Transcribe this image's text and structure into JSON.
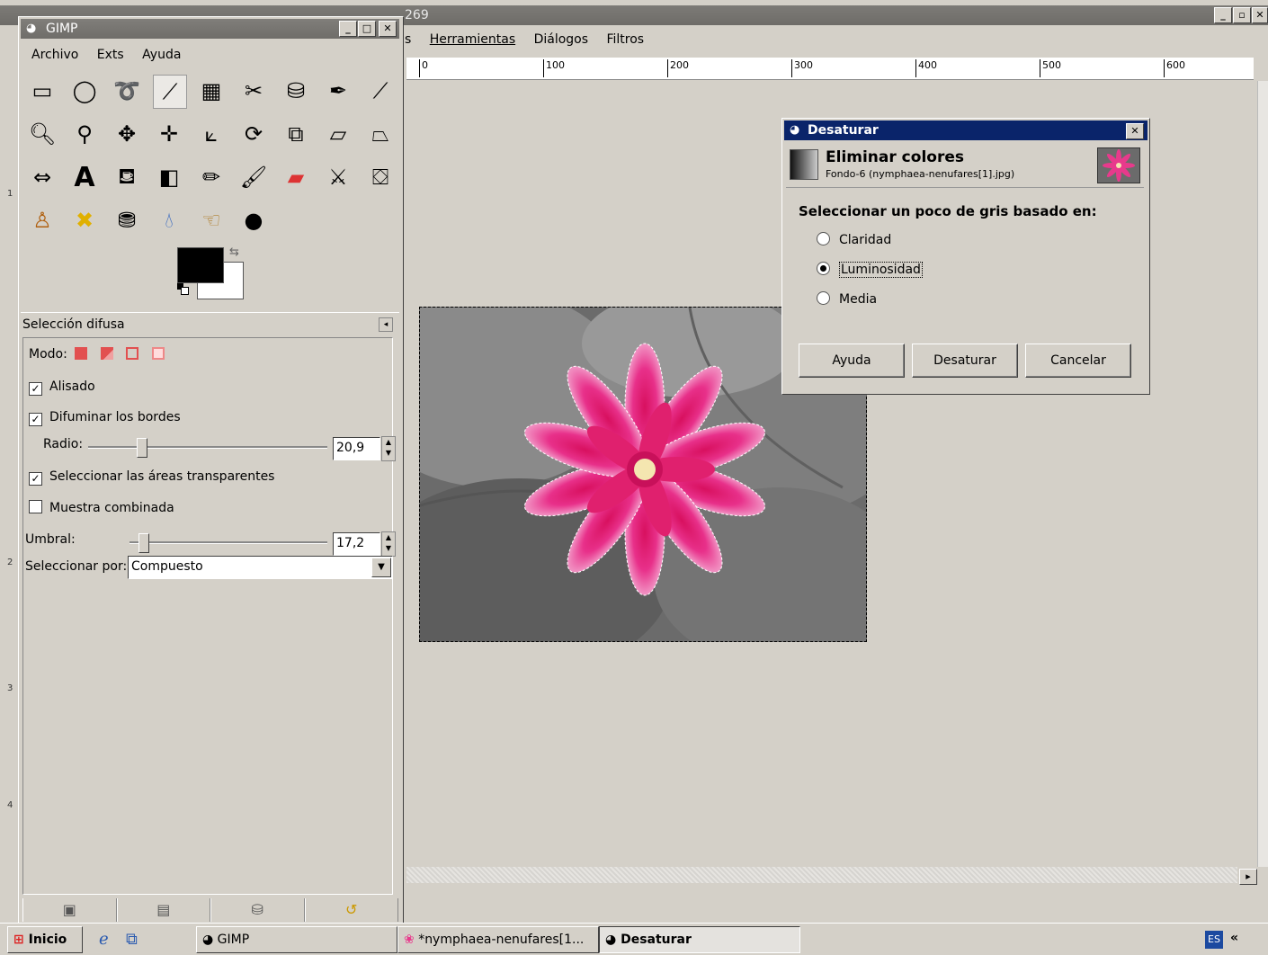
{
  "image_window": {
    "title": "269",
    "menu": [
      "s",
      "Herramientas",
      "Diálogos",
      "Filtros"
    ],
    "ruler_labels": [
      "0",
      "100",
      "200",
      "300",
      "400",
      "500",
      "600"
    ],
    "left_ruler_labels": [
      "1",
      "2",
      "3",
      "4"
    ]
  },
  "toolbox": {
    "title": "GIMP",
    "menu": [
      "Archivo",
      "Exts",
      "Ayuda"
    ],
    "tool_options": {
      "title": "Selección difusa",
      "mode_label": "Modo:",
      "antialias_label": "Alisado",
      "antialias_checked": true,
      "feather_label": "Difuminar los bordes",
      "feather_checked": true,
      "radius_label": "Radio:",
      "radius_value": "20,9",
      "radius_fraction": 0.22,
      "select_transparent_label": "Seleccionar las áreas transparentes",
      "select_transparent_checked": true,
      "sample_merged_label": "Muestra combinada",
      "sample_merged_checked": false,
      "threshold_label": "Umbral:",
      "threshold_value": "17,2",
      "threshold_fraction": 0.07,
      "select_by_label": "Seleccionar por:",
      "select_by_value": "Compuesto"
    }
  },
  "dialog": {
    "title": "Desaturar",
    "header_title": "Eliminar colores",
    "header_subtitle": "Fondo-6 (nymphaea-nenufares[1].jpg)",
    "prompt": "Seleccionar un poco de gris basado en:",
    "options": [
      "Claridad",
      "Luminosidad",
      "Media"
    ],
    "selected_option": "Luminosidad",
    "buttons": {
      "help": "Ayuda",
      "desaturate": "Desaturar",
      "cancel": "Cancelar"
    }
  },
  "taskbar": {
    "start_label": "Inicio",
    "tasks": [
      "GIMP",
      "*nymphaea-nenufares[1...",
      "Desaturar"
    ],
    "active_task": "Desaturar",
    "language": "ES",
    "tray_arrows": "«"
  },
  "colors": {
    "dialog_titlebar": "#0a246a",
    "flower_pink": "#e8207a",
    "window_bg": "#d4d0c8"
  }
}
